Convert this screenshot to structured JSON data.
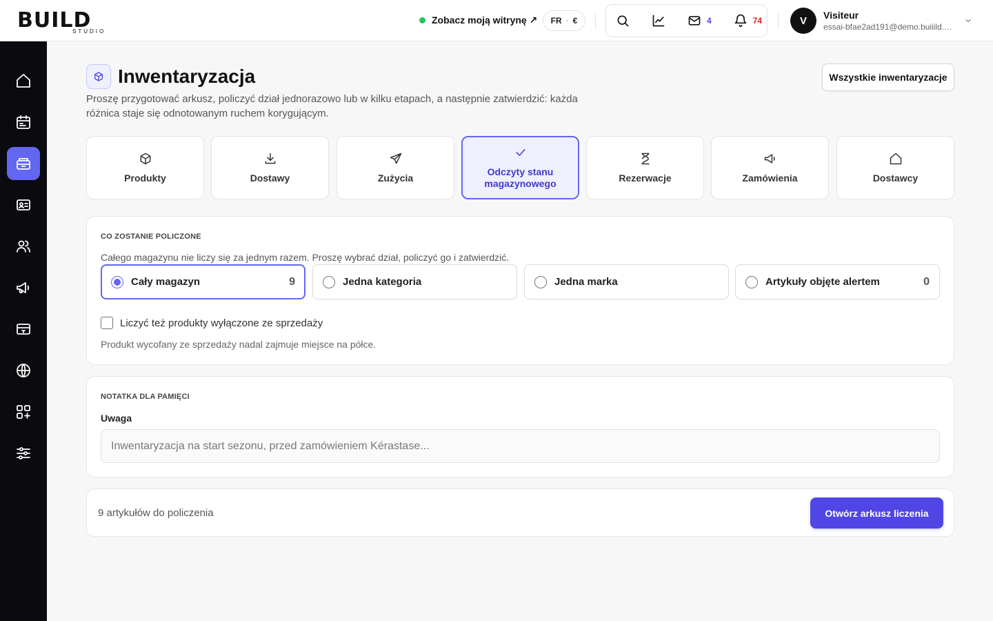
{
  "brand": {
    "logo_text": "BUILD",
    "logo_sub": "STUDIO"
  },
  "topbar": {
    "site_link": "Zobacz moją witrynę ↗",
    "lang": "FR",
    "currency": "€",
    "mail_count": "4",
    "notif_count": "74",
    "user": {
      "initial": "V",
      "name": "Visiteur",
      "email": "essai-bfae2ad191@demo.buiiild.com"
    }
  },
  "page": {
    "title": "Inwentaryzacja",
    "description": "Proszę przygotować arkusz, policzyć dział jednorazowo lub w kilku etapach, a następnie zatwierdzić: każda różnica staje się odnotowanym ruchem korygującym.",
    "all_button": "Wszystkie inwentaryzacje"
  },
  "tabs": [
    {
      "label": "Produkty",
      "icon": "box-icon"
    },
    {
      "label": "Dostawy",
      "icon": "download-icon"
    },
    {
      "label": "Zużycia",
      "icon": "send-icon"
    },
    {
      "label": "Odczyty stanu magazynowego",
      "icon": "check-icon",
      "active": true
    },
    {
      "label": "Rezerwacje",
      "icon": "hourglass-icon"
    },
    {
      "label": "Zamówienia",
      "icon": "megaphone-icon"
    },
    {
      "label": "Dostawcy",
      "icon": "home-icon"
    }
  ],
  "scope": {
    "title": "CO ZOSTANIE POLICZONE",
    "description": "Całego magazynu nie liczy się za jednym razem. Proszę wybrać dział, policzyć go i zatwierdzić.",
    "options": [
      {
        "label": "Cały magazyn",
        "count": "9",
        "selected": true
      },
      {
        "label": "Jedna kategoria",
        "count": ""
      },
      {
        "label": "Jedna marka",
        "count": ""
      },
      {
        "label": "Artykuły objęte alertem",
        "count": "0"
      }
    ],
    "checkbox_label": "Liczyć też produkty wyłączone ze sprzedaży",
    "checkbox_hint": "Produkt wycofany ze sprzedaży nadal zajmuje miejsce na półce."
  },
  "note": {
    "title": "NOTATKA DLA PAMIĘCI",
    "label": "Uwaga",
    "placeholder": "Inwentaryzacja na start sezonu, przed zamówieniem Kérastase..."
  },
  "footer": {
    "count_text": "9 artykułów do policzenia",
    "open_button": "Otwórz arkusz liczenia"
  },
  "sidebar": {
    "items": [
      {
        "icon": "home-icon"
      },
      {
        "icon": "calendar-icon"
      },
      {
        "icon": "inventory-icon",
        "active": true
      },
      {
        "icon": "contact-card-icon"
      },
      {
        "icon": "users-icon"
      },
      {
        "icon": "megaphone-icon"
      },
      {
        "icon": "payment-terminal-icon"
      },
      {
        "icon": "globe-icon"
      },
      {
        "icon": "apps-icon"
      },
      {
        "icon": "sliders-icon"
      }
    ]
  },
  "colors": {
    "accent": "#6366f1",
    "primary_button": "#4f46e5",
    "sidebar": "#0b0b0f",
    "online": "#22c55e",
    "alert": "#dc2626"
  }
}
